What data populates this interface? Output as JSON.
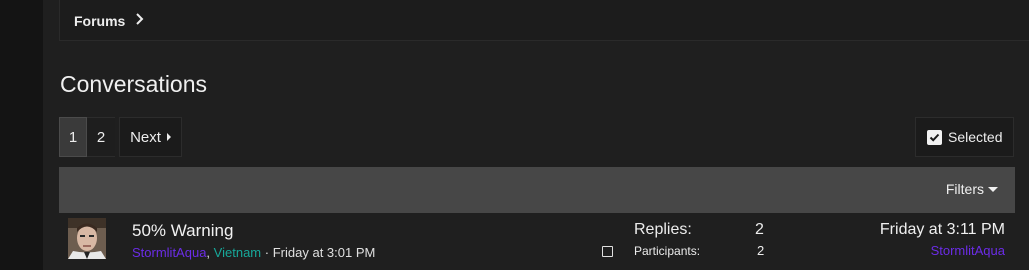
{
  "breadcrumb": {
    "label": "Forums"
  },
  "page_title": "Conversations",
  "pagination": {
    "pages": [
      "1",
      "2"
    ],
    "current": "1",
    "next_label": "Next"
  },
  "selected_label": "Selected",
  "filters_label": "Filters",
  "conversations": [
    {
      "title": "50% Warning",
      "participant_1": "StormlitAqua",
      "separator": ",",
      "participant_2": "Vietnam",
      "dot": "·",
      "started": "Friday at 3:01 PM",
      "replies_label": "Replies:",
      "replies": "2",
      "participants_label": "Participants:",
      "participants": "2",
      "last_time": "Friday at 3:11 PM",
      "last_user": "StormlitAqua"
    }
  ],
  "colors": {
    "background": "#1f1f1f",
    "filter_bar": "#474747",
    "username_primary": "#6b2ce6",
    "username_secondary": "#17a89a"
  }
}
